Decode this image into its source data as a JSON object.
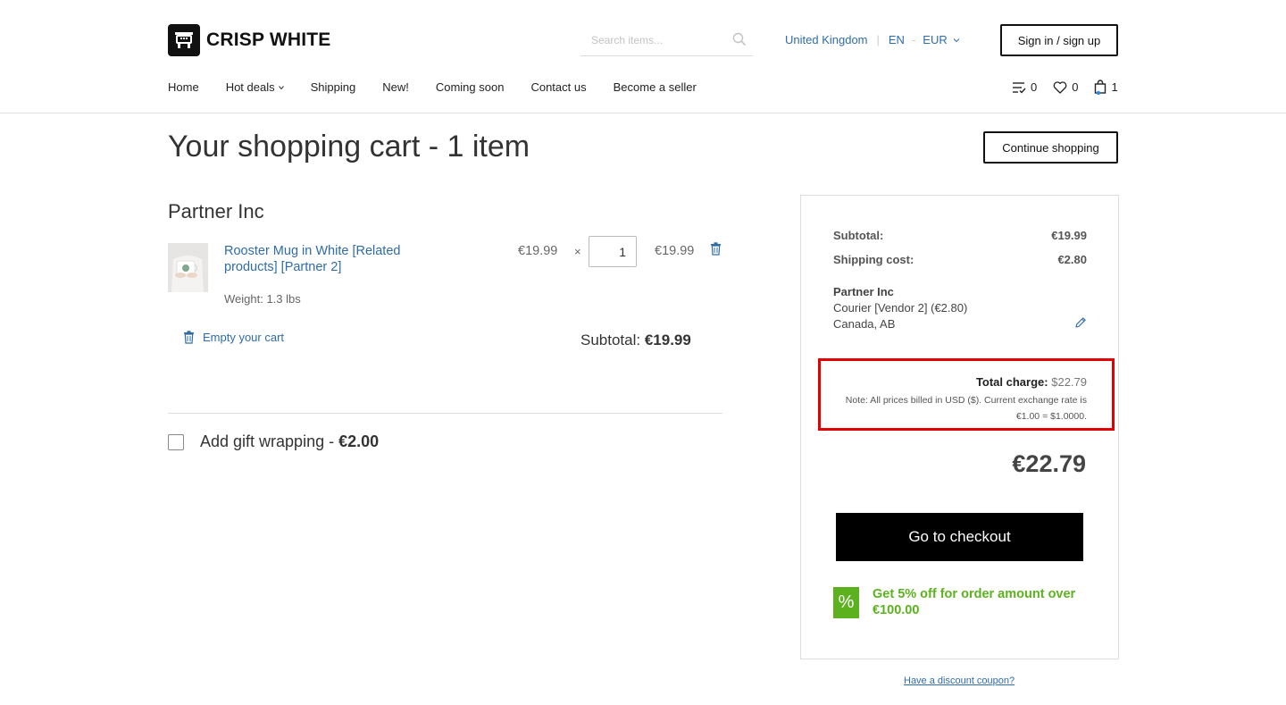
{
  "brand": {
    "name": "CRISP WHITE"
  },
  "search": {
    "placeholder": "Search items..."
  },
  "locale": {
    "country": "United Kingdom",
    "language": "EN",
    "currency": "EUR"
  },
  "header": {
    "signin_label": "Sign in / sign up"
  },
  "nav": {
    "items": [
      {
        "label": "Home"
      },
      {
        "label": "Hot deals",
        "has_dropdown": true
      },
      {
        "label": "Shipping"
      },
      {
        "label": "New!"
      },
      {
        "label": "Coming soon"
      },
      {
        "label": "Contact us"
      },
      {
        "label": "Become a seller"
      }
    ]
  },
  "counters": {
    "compare": "0",
    "wishlist": "0",
    "cart": "1"
  },
  "page": {
    "title": "Your shopping cart - 1 item",
    "continue_label": "Continue shopping"
  },
  "cart": {
    "vendor": "Partner Inc",
    "item": {
      "name": "Rooster Mug in White [Related products] [Partner 2]",
      "weight": "Weight: 1.3 lbs",
      "unit_price": "€19.99",
      "times": "×",
      "quantity": "1",
      "line_total": "€19.99"
    },
    "empty_label": "Empty your cart",
    "subtotal_label": "Subtotal:",
    "subtotal_value": "€19.99"
  },
  "gift": {
    "label": "Add gift wrapping - ",
    "price": "€2.00",
    "checked": false
  },
  "summary": {
    "subtotal_label": "Subtotal:",
    "subtotal_value": "€19.99",
    "shipping_label": "Shipping cost:",
    "shipping_value": "€2.80",
    "shipping_vendor": "Partner Inc",
    "shipping_method": "Courier [Vendor 2] (€2.80)",
    "shipping_region": "Canada, AB",
    "total_charge_label": "Total charge:",
    "total_charge_value": "$22.79",
    "note": "Note: All prices billed in USD ($). Current exchange rate is €1.00 = $1.0000.",
    "grand_total": "€22.79",
    "checkout_label": "Go to checkout",
    "promo_symbol": "%",
    "promo_text": "Get 5% off for order amount over €100.00",
    "coupon_link": "Have a discount coupon?"
  },
  "colors": {
    "link": "#2f6ca8",
    "promo": "#5cb21e",
    "highlight": "#e20000",
    "button_dark": "#000000"
  }
}
